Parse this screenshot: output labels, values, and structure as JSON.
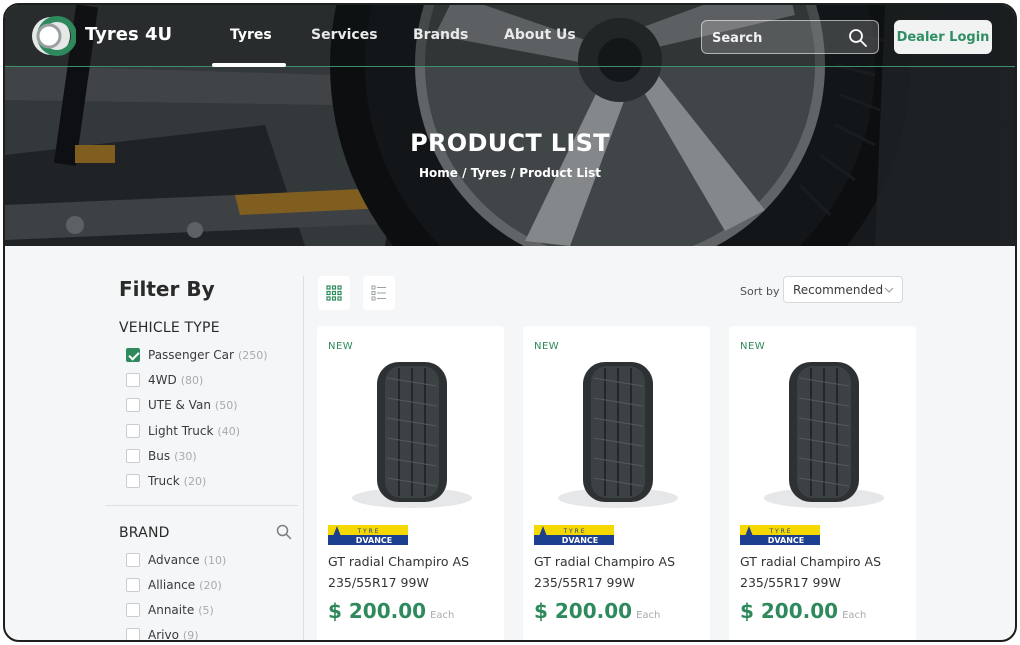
{
  "header": {
    "brand_name": "Tyres 4U",
    "nav": [
      {
        "label": "Tyres",
        "active": true
      },
      {
        "label": "Services",
        "active": false
      },
      {
        "label": "Brands",
        "active": false
      },
      {
        "label": "About Us",
        "active": false
      }
    ],
    "search": {
      "placeholder": "Search",
      "value": ""
    },
    "dealer_login_label": "Dealer Login",
    "accent_color": "#2e8a5c"
  },
  "hero": {
    "title": "PRODUCT LIST",
    "breadcrumb": [
      "Home",
      "Tyres",
      "Product List"
    ],
    "separator": "/"
  },
  "sidebar": {
    "title": "Filter By",
    "vehicle_type": {
      "title": "VEHICLE TYPE",
      "options": [
        {
          "label": "Passenger Car",
          "count": "(250)",
          "checked": true
        },
        {
          "label": "4WD",
          "count": "(80)",
          "checked": false
        },
        {
          "label": "UTE & Van",
          "count": "(50)",
          "checked": false
        },
        {
          "label": "Light Truck",
          "count": "(40)",
          "checked": false
        },
        {
          "label": "Bus",
          "count": "(30)",
          "checked": false
        },
        {
          "label": "Truck",
          "count": "(20)",
          "checked": false
        }
      ]
    },
    "brand": {
      "title": "BRAND",
      "options": [
        {
          "label": "Advance",
          "count": "(10)",
          "checked": false
        },
        {
          "label": "Alliance",
          "count": "(20)",
          "checked": false
        },
        {
          "label": "Annaite",
          "count": "(5)",
          "checked": false
        },
        {
          "label": "Arivo",
          "count": "(9)",
          "checked": false
        }
      ]
    }
  },
  "toolbar": {
    "sort_label": "Sort by :",
    "sort_value": "Recommended",
    "view_modes": [
      "grid",
      "list"
    ],
    "active_view": "grid"
  },
  "products": [
    {
      "badge": "NEW",
      "brand_logo_text": {
        "top": "T Y R E",
        "main": "DVANCE",
        "letter": "A"
      },
      "name": "GT radial Champiro AS",
      "size": "235/55R17 99W",
      "price": "$ 200.00",
      "unit": "Each"
    },
    {
      "badge": "NEW",
      "brand_logo_text": {
        "top": "T Y R E",
        "main": "DVANCE",
        "letter": "A"
      },
      "name": "GT radial Champiro AS",
      "size": "235/55R17 99W",
      "price": "$ 200.00",
      "unit": "Each"
    },
    {
      "badge": "NEW",
      "brand_logo_text": {
        "top": "T Y R E",
        "main": "DVANCE",
        "letter": "A"
      },
      "name": "GT radial Champiro AS",
      "size": "235/55R17 99W",
      "price": "$ 200.00",
      "unit": "Each"
    }
  ]
}
